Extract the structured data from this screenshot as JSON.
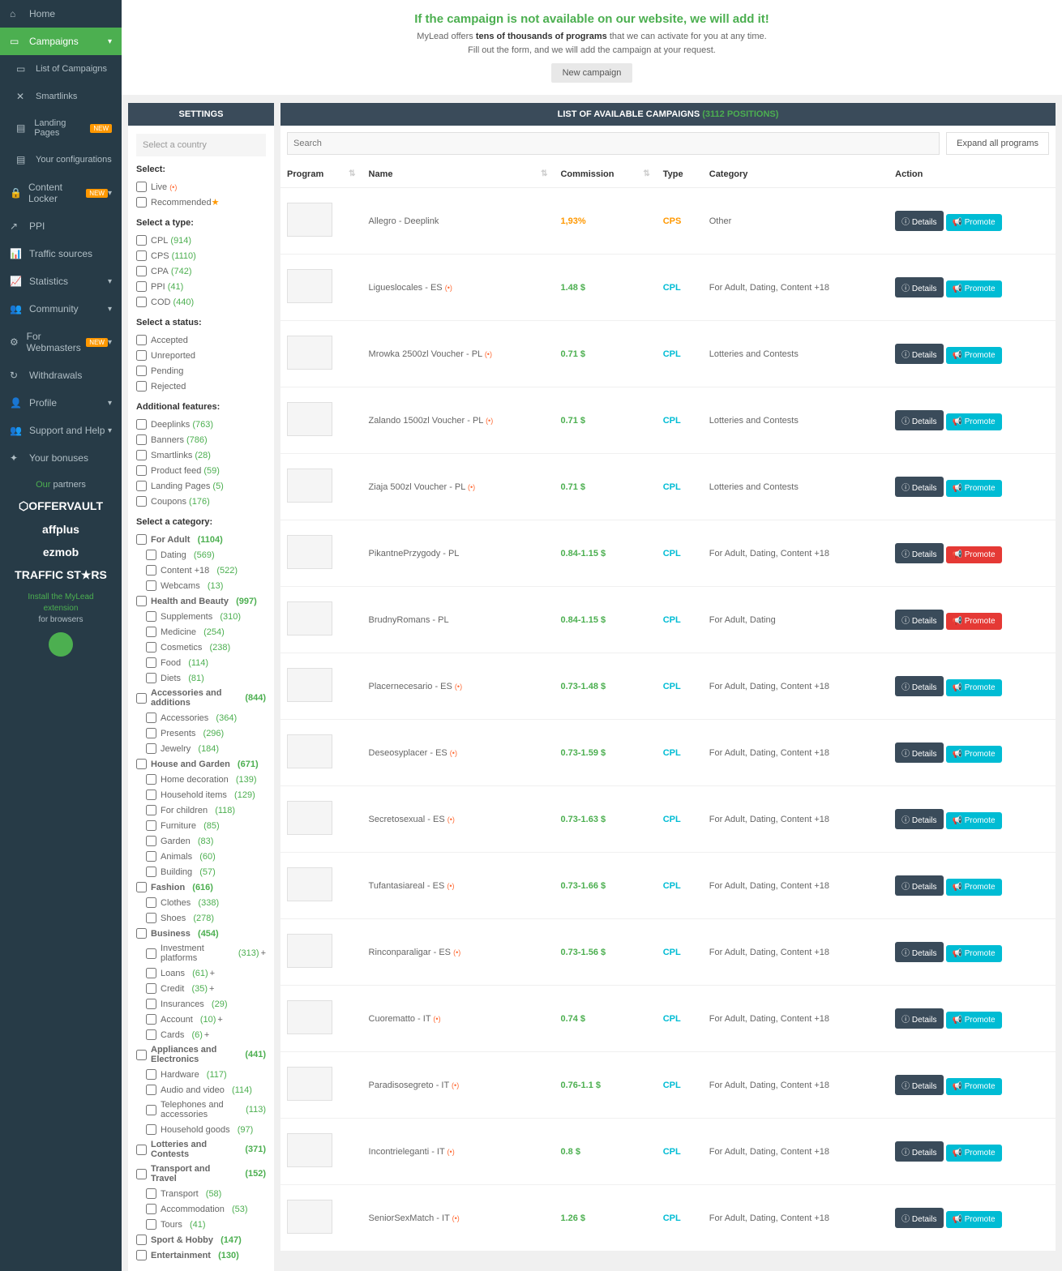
{
  "sidebar": {
    "items": [
      {
        "icon": "⌂",
        "label": "Home"
      },
      {
        "icon": "▭",
        "label": "Campaigns",
        "active": true,
        "chevron": "▾"
      },
      {
        "icon": "▭",
        "label": "List of Campaigns",
        "sub": true
      },
      {
        "icon": "✕",
        "label": "Smartlinks",
        "sub": true
      },
      {
        "icon": "▤",
        "label": "Landing Pages",
        "sub": true,
        "badge": "NEW"
      },
      {
        "icon": "▤",
        "label": "Your configurations",
        "sub": true
      },
      {
        "icon": "🔒",
        "label": "Content Locker",
        "badge": "NEW",
        "chevron": "▾"
      },
      {
        "icon": "↗",
        "label": "PPI"
      },
      {
        "icon": "📊",
        "label": "Traffic sources"
      },
      {
        "icon": "📈",
        "label": "Statistics",
        "chevron": "▾"
      },
      {
        "icon": "👥",
        "label": "Community",
        "chevron": "▾"
      },
      {
        "icon": "⚙",
        "label": "For Webmasters",
        "badge": "NEW",
        "chevron": "▾"
      },
      {
        "icon": "↻",
        "label": "Withdrawals"
      },
      {
        "icon": "👤",
        "label": "Profile",
        "chevron": "▾"
      },
      {
        "icon": "👥",
        "label": "Support and Help",
        "chevron": "▾"
      },
      {
        "icon": "✦",
        "label": "Your bonuses"
      }
    ],
    "partners_title_our": "Our",
    "partners_title_partners": "partners",
    "partners": [
      "⬡OFFERVAULT",
      "affplus",
      "ezmob",
      "TRAFFIC ST★RS"
    ],
    "install": {
      "l1": "Install the MyLead",
      "l2": "extension",
      "l3": "for browsers"
    }
  },
  "banner": {
    "title": "If the campaign is not available on our website, we will add it!",
    "text1": "MyLead offers ",
    "text1b": "tens of thousands of programs",
    "text2": " that we can activate for you at any time.",
    "text3": "Fill out the form, and we will add the campaign at your request.",
    "btn": "New campaign"
  },
  "settings": {
    "header": "SETTINGS",
    "select_country": "Select a country",
    "select_label": "Select:",
    "select_items": [
      {
        "label": "Live",
        "tag": "(•)"
      },
      {
        "label": "Recommended",
        "star": "★"
      }
    ],
    "type_label": "Select a type:",
    "types": [
      {
        "label": "CPL",
        "count": "(914)"
      },
      {
        "label": "CPS",
        "count": "(1110)"
      },
      {
        "label": "CPA",
        "count": "(742)"
      },
      {
        "label": "PPI",
        "count": "(41)"
      },
      {
        "label": "COD",
        "count": "(440)"
      }
    ],
    "status_label": "Select a status:",
    "statuses": [
      {
        "label": "Accepted"
      },
      {
        "label": "Unreported"
      },
      {
        "label": "Pending"
      },
      {
        "label": "Rejected"
      }
    ],
    "features_label": "Additional features:",
    "features": [
      {
        "label": "Deeplinks",
        "count": "(763)"
      },
      {
        "label": "Banners",
        "count": "(786)"
      },
      {
        "label": "Smartlinks",
        "count": "(28)"
      },
      {
        "label": "Product feed",
        "count": "(59)"
      },
      {
        "label": "Landing Pages",
        "count": "(5)"
      },
      {
        "label": "Coupons",
        "count": "(176)"
      }
    ],
    "category_label": "Select a category:",
    "categories": [
      {
        "label": "For Adult",
        "count": "(1104)",
        "subs": [
          {
            "label": "Dating",
            "count": "(569)"
          },
          {
            "label": "Content +18",
            "count": "(522)"
          },
          {
            "label": "Webcams",
            "count": "(13)"
          }
        ]
      },
      {
        "label": "Health and Beauty",
        "count": "(997)",
        "subs": [
          {
            "label": "Supplements",
            "count": "(310)"
          },
          {
            "label": "Medicine",
            "count": "(254)"
          },
          {
            "label": "Cosmetics",
            "count": "(238)"
          },
          {
            "label": "Food",
            "count": "(114)"
          },
          {
            "label": "Diets",
            "count": "(81)"
          }
        ]
      },
      {
        "label": "Accessories and additions",
        "count": "(844)",
        "subs": [
          {
            "label": "Accessories",
            "count": "(364)"
          },
          {
            "label": "Presents",
            "count": "(296)"
          },
          {
            "label": "Jewelry",
            "count": "(184)"
          }
        ]
      },
      {
        "label": "House and Garden",
        "count": "(671)",
        "subs": [
          {
            "label": "Home decoration",
            "count": "(139)"
          },
          {
            "label": "Household items",
            "count": "(129)"
          },
          {
            "label": "For children",
            "count": "(118)"
          },
          {
            "label": "Furniture",
            "count": "(85)"
          },
          {
            "label": "Garden",
            "count": "(83)"
          },
          {
            "label": "Animals",
            "count": "(60)"
          },
          {
            "label": "Building",
            "count": "(57)"
          }
        ]
      },
      {
        "label": "Fashion",
        "count": "(616)",
        "subs": [
          {
            "label": "Clothes",
            "count": "(338)"
          },
          {
            "label": "Shoes",
            "count": "(278)"
          }
        ]
      },
      {
        "label": "Business",
        "count": "(454)",
        "subs": [
          {
            "label": "Investment platforms",
            "count": "(313)",
            "plus": "+"
          },
          {
            "label": "Loans",
            "count": "(61)",
            "plus": "+"
          },
          {
            "label": "Credit",
            "count": "(35)",
            "plus": "+"
          },
          {
            "label": "Insurances",
            "count": "(29)"
          },
          {
            "label": "Account",
            "count": "(10)",
            "plus": "+"
          },
          {
            "label": "Cards",
            "count": "(6)",
            "plus": "+"
          }
        ]
      },
      {
        "label": "Appliances and Electronics",
        "count": "(441)",
        "subs": [
          {
            "label": "Hardware",
            "count": "(117)"
          },
          {
            "label": "Audio and video",
            "count": "(114)"
          },
          {
            "label": "Telephones and accessories",
            "count": "(113)"
          },
          {
            "label": "Household goods",
            "count": "(97)"
          }
        ]
      },
      {
        "label": "Lotteries and Contests",
        "count": "(371)"
      },
      {
        "label": "Transport and Travel",
        "count": "(152)",
        "subs": [
          {
            "label": "Transport",
            "count": "(58)"
          },
          {
            "label": "Accommodation",
            "count": "(53)"
          },
          {
            "label": "Tours",
            "count": "(41)"
          }
        ]
      },
      {
        "label": "Sport & Hobby",
        "count": "(147)"
      },
      {
        "label": "Entertainment",
        "count": "(130)"
      }
    ]
  },
  "list": {
    "header_text": "LIST OF AVAILABLE CAMPAIGNS ",
    "header_positions": "(3112 POSITIONS)",
    "search_placeholder": "Search",
    "expand_btn": "Expand all programs",
    "columns": {
      "program": "Program",
      "name": "Name",
      "commission": "Commission",
      "type": "Type",
      "category": "Category",
      "action": "Action"
    },
    "details_btn": "Details",
    "promote_btn": "Promote",
    "rows": [
      {
        "name": "Allegro - Deeplink",
        "comm": "1,93%",
        "comm_orange": true,
        "type": "CPS",
        "cat": "Other"
      },
      {
        "name": "Ligueslocales - ES",
        "flag": "(•)",
        "comm": "1.48 $",
        "type": "CPL",
        "cat": "For Adult, Dating, Content +18"
      },
      {
        "name": "Mrowka 2500zl Voucher - PL",
        "flag": "(•)",
        "comm": "0.71 $",
        "type": "CPL",
        "cat": "Lotteries and Contests"
      },
      {
        "name": "Zalando 1500zl Voucher - PL",
        "flag": "(•)",
        "comm": "0.71 $",
        "type": "CPL",
        "cat": "Lotteries and Contests"
      },
      {
        "name": "Ziaja 500zl Voucher - PL",
        "flag": "(•)",
        "comm": "0.71 $",
        "type": "CPL",
        "cat": "Lotteries and Contests"
      },
      {
        "name": "PikantnePrzygody - PL",
        "comm": "0.84-1.15 $",
        "type": "CPL",
        "cat": "For Adult, Dating, Content +18",
        "red": true
      },
      {
        "name": "BrudnyRomans - PL",
        "comm": "0.84-1.15 $",
        "type": "CPL",
        "cat": "For Adult, Dating",
        "red": true
      },
      {
        "name": "Placernecesario - ES",
        "flag": "(•)",
        "comm": "0.73-1.48 $",
        "type": "CPL",
        "cat": "For Adult, Dating, Content +18"
      },
      {
        "name": "Deseosyplacer - ES",
        "flag": "(•)",
        "comm": "0.73-1.59 $",
        "type": "CPL",
        "cat": "For Adult, Dating, Content +18"
      },
      {
        "name": "Secretosexual - ES",
        "flag": "(•)",
        "comm": "0.73-1.63 $",
        "type": "CPL",
        "cat": "For Adult, Dating, Content +18"
      },
      {
        "name": "Tufantasiareal - ES",
        "flag": "(•)",
        "comm": "0.73-1.66 $",
        "type": "CPL",
        "cat": "For Adult, Dating, Content +18"
      },
      {
        "name": "Rinconparaligar - ES",
        "flag": "(•)",
        "comm": "0.73-1.56 $",
        "type": "CPL",
        "cat": "For Adult, Dating, Content +18"
      },
      {
        "name": "Cuorematto - IT",
        "flag": "(•)",
        "comm": "0.74 $",
        "type": "CPL",
        "cat": "For Adult, Dating, Content +18"
      },
      {
        "name": "Paradisosegreto - IT",
        "flag": "(•)",
        "comm": "0.76-1.1 $",
        "type": "CPL",
        "cat": "For Adult, Dating, Content +18"
      },
      {
        "name": "Incontrieleganti - IT",
        "flag": "(•)",
        "comm": "0.8 $",
        "type": "CPL",
        "cat": "For Adult, Dating, Content +18"
      },
      {
        "name": "SeniorSexMatch - IT",
        "flag": "(•)",
        "comm": "1.26 $",
        "type": "CPL",
        "cat": "For Adult, Dating, Content +18"
      }
    ]
  }
}
